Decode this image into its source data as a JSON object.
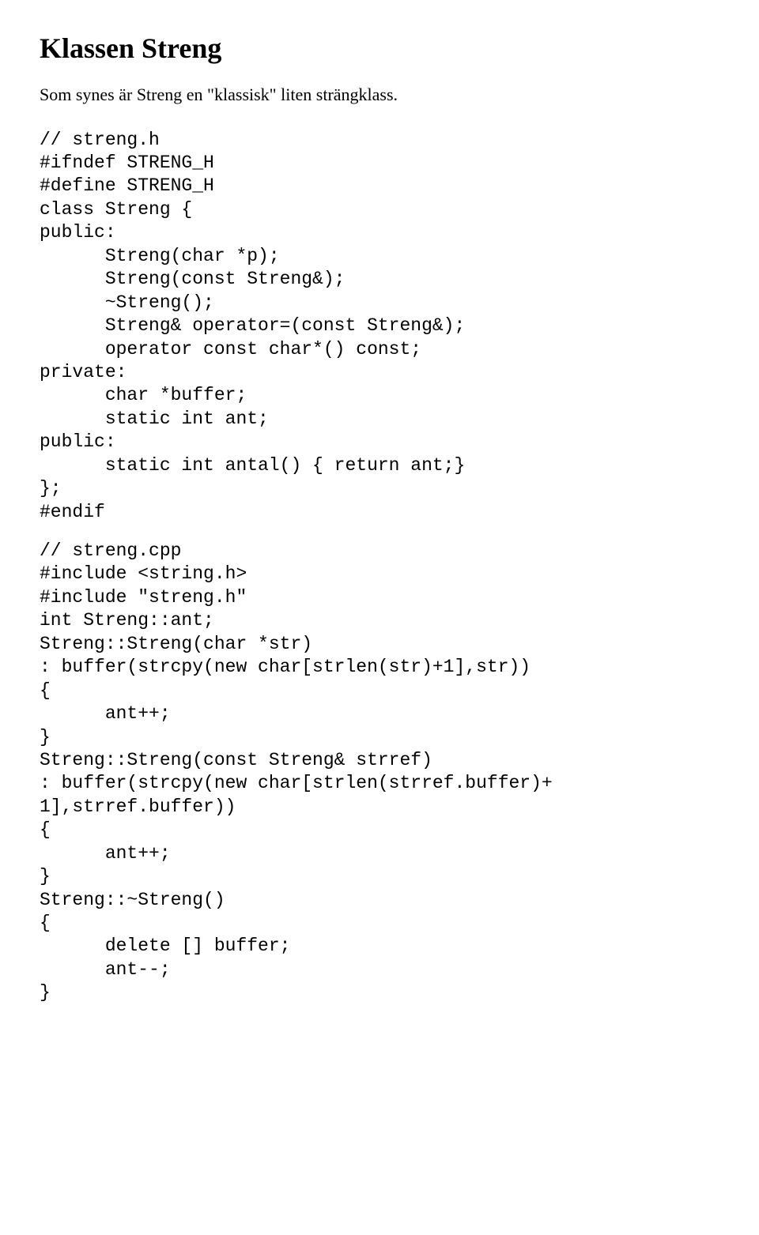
{
  "heading": "Klassen Streng",
  "intro": "Som synes är Streng en \"klassisk\" liten strängklass.",
  "code_block_1": "// streng.h\n#ifndef STRENG_H\n#define STRENG_H\nclass Streng {\npublic:\n      Streng(char *p);\n      Streng(const Streng&);\n      ~Streng();\n      Streng& operator=(const Streng&);\n      operator const char*() const;\nprivate:\n      char *buffer;\n      static int ant;\npublic:\n      static int antal() { return ant;}\n};\n#endif",
  "code_block_2": "// streng.cpp\n#include <string.h>\n#include \"streng.h\"\nint Streng::ant;\nStreng::Streng(char *str)\n: buffer(strcpy(new char[strlen(str)+1],str))\n{\n      ant++;\n}\nStreng::Streng(const Streng& strref)\n: buffer(strcpy(new char[strlen(strref.buffer)+\n1],strref.buffer))\n{\n      ant++;\n}\nStreng::~Streng()\n{\n      delete [] buffer;\n      ant--;\n}"
}
